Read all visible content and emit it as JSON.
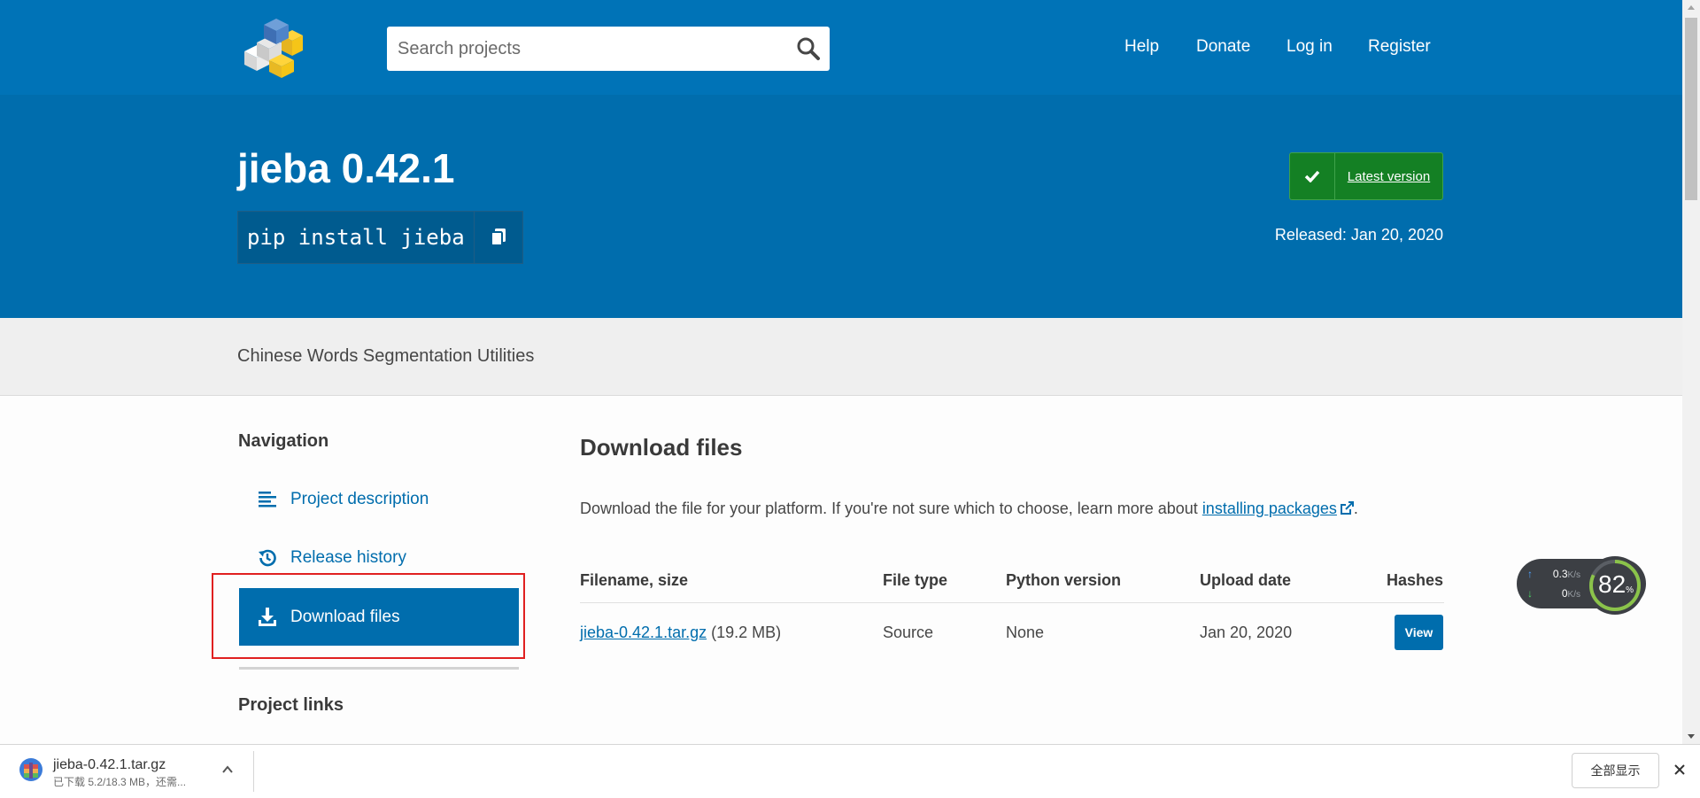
{
  "header": {
    "search_placeholder": "Search projects",
    "nav": [
      "Help",
      "Donate",
      "Log in",
      "Register"
    ]
  },
  "banner": {
    "title": "jieba 0.42.1",
    "pip_command": "pip install jieba",
    "latest_version_label": "Latest version",
    "released": "Released: Jan 20, 2020"
  },
  "summary": "Chinese Words Segmentation Utilities",
  "sidebar": {
    "heading": "Navigation",
    "items": [
      {
        "label": "Project description",
        "icon": "align-left-icon"
      },
      {
        "label": "Release history",
        "icon": "history-icon"
      },
      {
        "label": "Download files",
        "icon": "download-icon",
        "active": true
      }
    ],
    "project_links_heading": "Project links"
  },
  "main": {
    "heading": "Download files",
    "intro_text": "Download the file for your platform. If you're not sure which to choose, learn more about ",
    "intro_link": "installing packages",
    "intro_end": ".",
    "table": {
      "headers": [
        "Filename, size",
        "File type",
        "Python version",
        "Upload date",
        "Hashes"
      ],
      "rows": [
        {
          "filename": "jieba-0.42.1.tar.gz",
          "size": "(19.2 MB)",
          "file_type": "Source",
          "python_version": "None",
          "upload_date": "Jan 20, 2020",
          "hashes_button": "View"
        }
      ]
    }
  },
  "speed_widget": {
    "upload": "0.3",
    "upload_unit": "K/s",
    "download": "0",
    "download_unit": "K/s",
    "percent": "82",
    "percent_unit": "%",
    "gauge_fraction": 0.82
  },
  "download_bar": {
    "filename": "jieba-0.42.1.tar.gz",
    "status": "已下载 5.2/18.3 MB，还需...",
    "show_all": "全部显示"
  },
  "colors": {
    "header": "#0073b7",
    "banner": "#006dad",
    "link": "#006dad",
    "latest_version": "#148024",
    "highlight_border": "#e02020"
  }
}
